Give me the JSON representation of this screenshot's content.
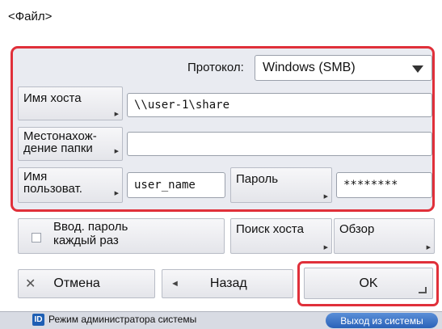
{
  "title": "<Файл>",
  "protocol": {
    "label": "Протокол:",
    "value": "Windows (SMB)"
  },
  "host": {
    "button": "Имя хоста",
    "value": "\\\\user-1\\share"
  },
  "folder": {
    "button_line1": "Местонахож-",
    "button_line2": "дение папки",
    "value": ""
  },
  "user": {
    "button_line1": "Имя",
    "button_line2": "пользоват.",
    "value": "user_name"
  },
  "password": {
    "button": "Пароль",
    "value": "********"
  },
  "options": {
    "ask_password_line1": "Ввод. пароль",
    "ask_password_line2": "каждый раз",
    "search_host": "Поиск хоста",
    "browse": "Обзор"
  },
  "actions": {
    "cancel_icon": "✕",
    "cancel": "Отмена",
    "back_icon": "◄",
    "back": "Назад",
    "ok": "OK"
  },
  "status_bar": {
    "admin_icon": "ID",
    "admin_text": "Режим администратора системы",
    "logout": "Выход из системы"
  }
}
